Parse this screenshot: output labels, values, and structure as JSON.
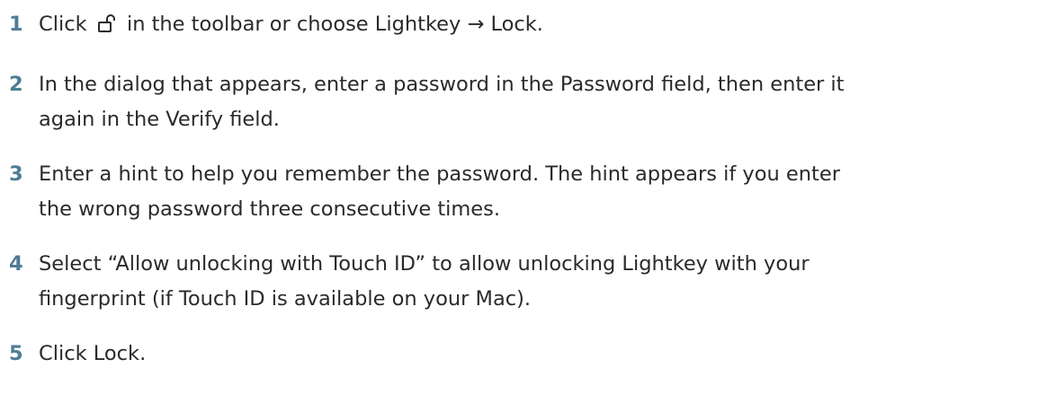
{
  "accent_color": "#4f7c95",
  "text_color": "#2a2a2a",
  "steps": [
    {
      "number": "1",
      "before_icon": "Click",
      "icon": "lock-open-icon",
      "after_icon": "in the toolbar or choose Lightkey → Lock."
    },
    {
      "number": "2",
      "line1": "In the dialog that appears, enter a password in the Password field, then enter it",
      "line2": "again in the Verify field."
    },
    {
      "number": "3",
      "line1": "Enter a hint to help you remember the password. The hint appears if you enter",
      "line2": "the wrong password three consecutive times."
    },
    {
      "number": "4",
      "line1": "Select “Allow unlocking with Touch ID” to allow unlocking Lightkey with your",
      "line2": "fingerprint (if Touch ID is available on your Mac)."
    },
    {
      "number": "5",
      "line1": "Click Lock."
    }
  ]
}
